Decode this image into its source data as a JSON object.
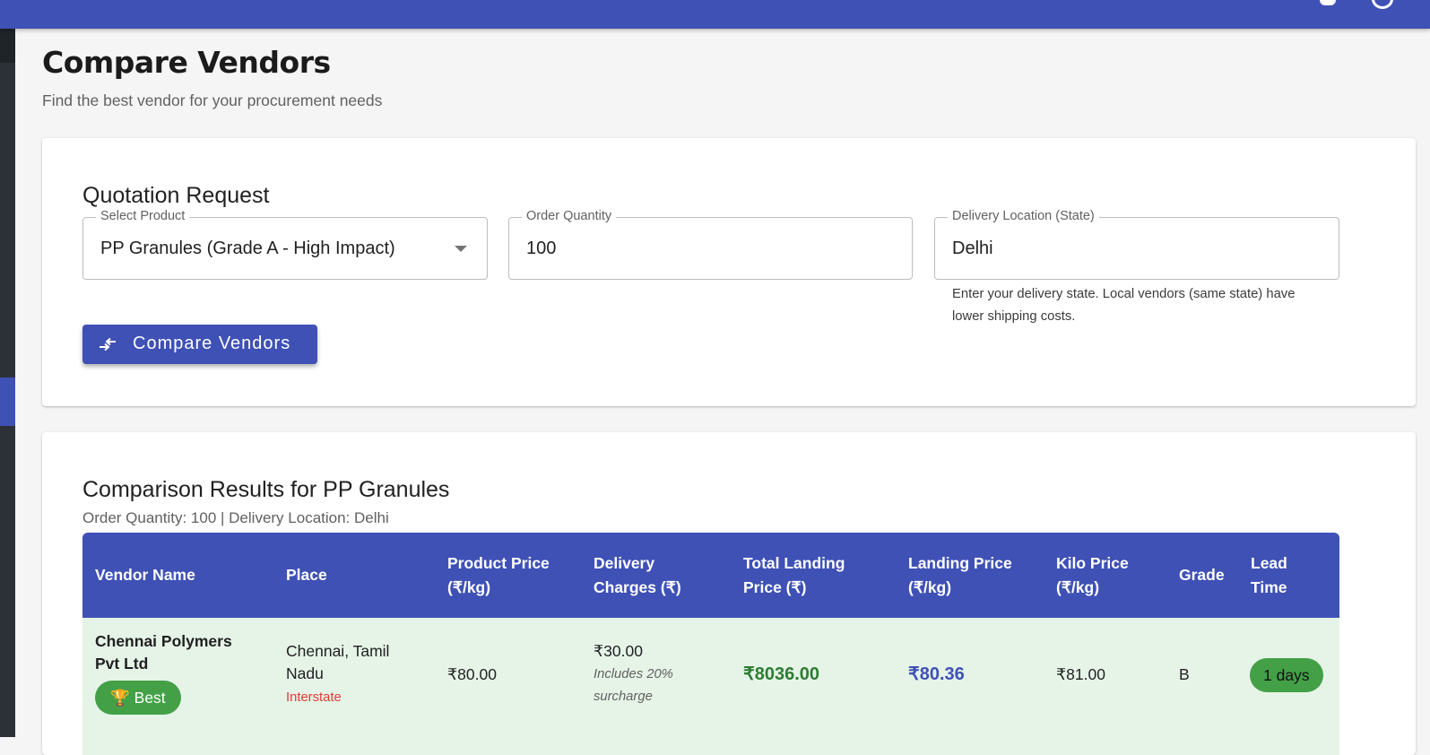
{
  "page": {
    "title": "Compare Vendors",
    "subtitle": "Find the best vendor for your procurement needs"
  },
  "topbar": {
    "icons": [
      "bell-icon",
      "account-circle-icon"
    ],
    "color": "#3f51b5"
  },
  "request": {
    "title": "Quotation Request",
    "product": {
      "label": "Select Product",
      "value": "PP Granules (Grade A - High Impact)"
    },
    "quantity": {
      "label": "Order Quantity",
      "value": "100"
    },
    "location": {
      "label": "Delivery Location (State)",
      "value": "Delhi",
      "helper": "Enter your delivery state. Local vendors (same state) have lower shipping costs."
    },
    "compare_button": "Compare Vendors",
    "compare_icon": "compare-arrows-icon"
  },
  "results": {
    "title": "Comparison Results for PP Granules",
    "subtitle": "Order Quantity: 100 | Delivery Location: Delhi",
    "columns": [
      "Vendor Name",
      "Place",
      "Product Price (₹/kg)",
      "Delivery Charges (₹)",
      "Total Landing Price (₹)",
      "Landing Price (₹/kg)",
      "Kilo Price (₹/kg)",
      "Grade",
      "Lead Time"
    ],
    "rows": [
      {
        "vendor": "Chennai Polymers Pvt Ltd",
        "badge": "🏆 Best",
        "place": "Chennai, Tamil Nadu",
        "place_note": "Interstate",
        "product_price": "₹80.00",
        "delivery": "₹30.00",
        "delivery_note": "Includes 20% surcharge",
        "total_landing": "₹8036.00",
        "landing_per_kg": "₹80.36",
        "kilo_price": "₹81.00",
        "grade": "B",
        "lead_time": "1 days"
      }
    ]
  },
  "colors": {
    "primary": "#3f51b5",
    "success": "#43a047",
    "best_row_bg": "#e6f4e8",
    "total_text": "#2e7d32",
    "interstate_text": "#e53935"
  }
}
